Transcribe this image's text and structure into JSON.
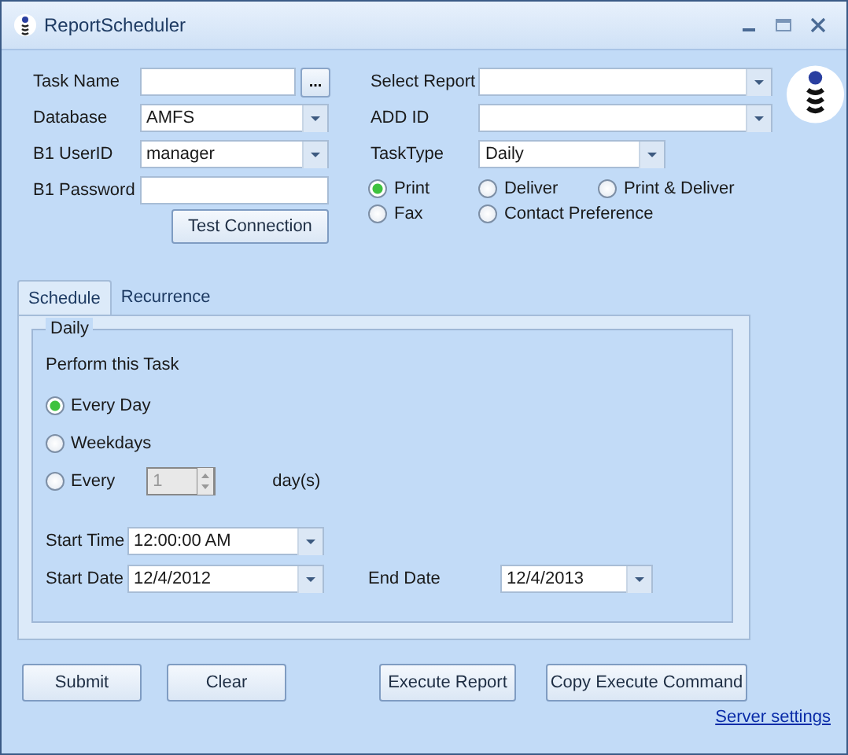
{
  "window": {
    "title": "ReportScheduler"
  },
  "left_fields": [
    {
      "label": "Task Name",
      "kind": "browse",
      "browse": "..."
    },
    {
      "label": "Database",
      "kind": "combo",
      "value": "AMFS"
    },
    {
      "label": "B1 UserID",
      "kind": "combo",
      "value": "manager"
    },
    {
      "label": "B1 Password",
      "kind": "text"
    }
  ],
  "test_connection": "Test Connection",
  "right_fields": [
    {
      "label": "Select Report",
      "kind": "combo"
    },
    {
      "label": "ADD ID",
      "kind": "combo"
    },
    {
      "label": "TaskType",
      "kind": "short-combo",
      "value": "Daily"
    }
  ],
  "output_options": [
    {
      "label": "Print",
      "selected": true
    },
    {
      "label": "Deliver",
      "selected": false
    },
    {
      "label": "Print &  Deliver",
      "selected": false
    },
    {
      "label": "Fax",
      "selected": false
    },
    {
      "label": "Contact Preference",
      "selected": false
    }
  ],
  "tabs": [
    {
      "label": "Schedule",
      "selected": true
    },
    {
      "label": "Recurrence",
      "selected": false
    }
  ],
  "schedule": {
    "group": "Daily",
    "prompt": "Perform this Task",
    "options": [
      {
        "label": "Every Day",
        "selected": true,
        "kind": "plain"
      },
      {
        "label": "Weekdays",
        "selected": false,
        "kind": "plain"
      },
      {
        "label": "Every",
        "selected": false,
        "kind": "interval"
      }
    ],
    "interval": {
      "value": "1",
      "disabled": true,
      "unit": "day(s)"
    },
    "start_time": {
      "label": "Start Time",
      "value": "12:00:00 AM"
    },
    "start_date": {
      "label": "Start Date",
      "value": "12/4/2012"
    },
    "end_date": {
      "label": "End Date",
      "value": "12/4/2013"
    }
  },
  "buttons": [
    "Submit",
    "Clear",
    "Execute Report",
    "Copy Execute Command"
  ],
  "link": "Server settings"
}
